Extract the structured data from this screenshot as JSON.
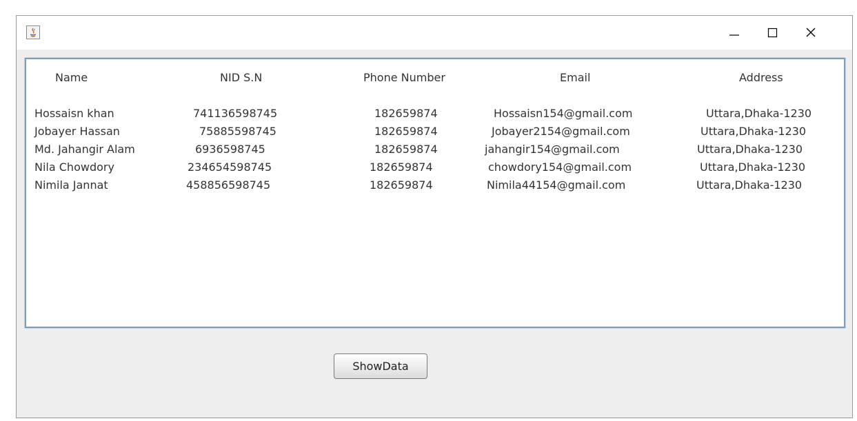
{
  "window": {
    "icon": "java-icon",
    "controls": {
      "minimize": "minimize-icon",
      "maximize": "maximize-icon",
      "close": "close-icon"
    }
  },
  "table": {
    "headers": [
      "Name",
      "NID S.N",
      "Phone Number",
      "Email",
      "Address"
    ],
    "rows": [
      [
        "Hossaisn khan",
        "741136598745",
        "182659874",
        "Hossaisn154@gmail.com",
        "Uttara,Dhaka-1230"
      ],
      [
        "Jobayer Hassan",
        "75885598745",
        "182659874",
        "Jobayer2154@gmail.com",
        "Uttara,Dhaka-1230"
      ],
      [
        "Md. Jahangir Alam",
        "6936598745",
        "182659874",
        "jahangir154@gmail.com",
        "Uttara,Dhaka-1230"
      ],
      [
        "Nila Chowdory",
        "234654598745",
        "182659874",
        "chowdory154@gmail.com",
        "Uttara,Dhaka-1230"
      ],
      [
        "Nimila Jannat",
        "458856598745",
        "182659874",
        "Nimila44154@gmail.com",
        "Uttara,Dhaka-1230"
      ]
    ]
  },
  "buttons": {
    "show_data": "ShowData"
  }
}
